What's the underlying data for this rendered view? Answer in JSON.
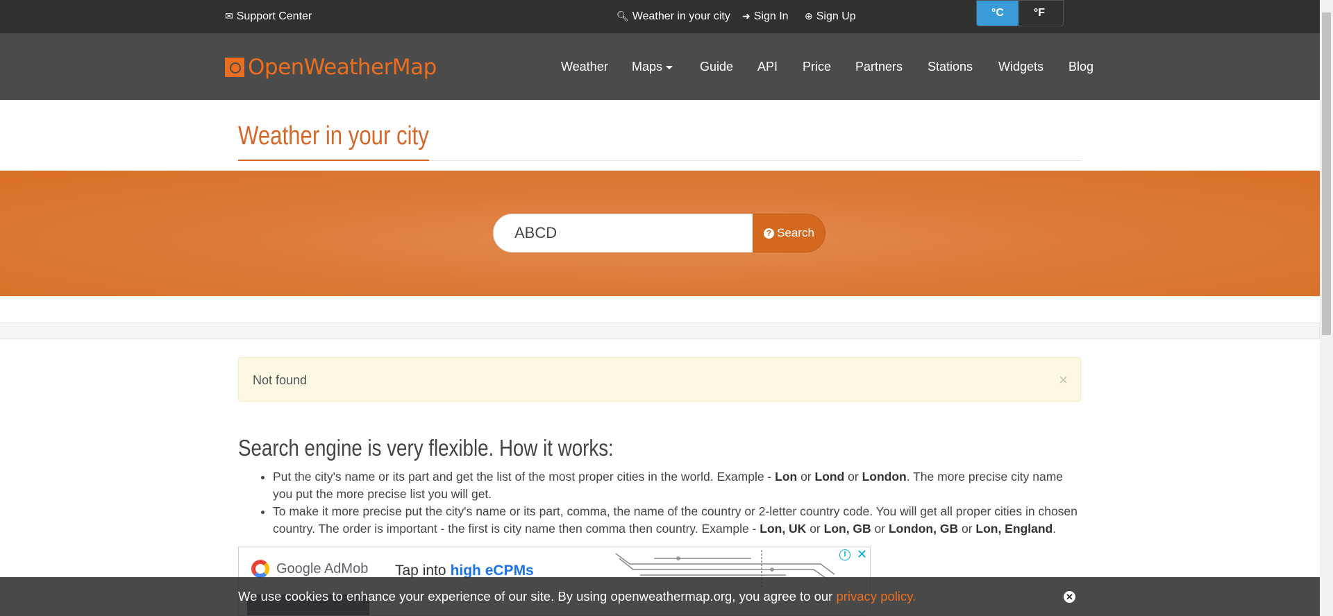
{
  "topbar": {
    "support": "Support Center",
    "weather_city": "Weather in your city",
    "sign_in": "Sign In",
    "sign_up": "Sign Up",
    "unit_c": "°C",
    "unit_f": "°F"
  },
  "navbar": {
    "logo": "OpenWeatherMap",
    "items": [
      "Weather",
      "Maps",
      "Guide",
      "API",
      "Price",
      "Partners",
      "Stations",
      "Widgets",
      "Blog"
    ]
  },
  "page": {
    "title": "Weather in your city"
  },
  "search": {
    "value": "ABCD",
    "button": "Search"
  },
  "alert": {
    "message": "Not found",
    "close": "×"
  },
  "info": {
    "title": "Search engine is very flexible. How it works:",
    "item1": {
      "t1": "Put the city's name or its part and get the list of the most proper cities in the world. Example - ",
      "b1": "Lon",
      "t2": " or ",
      "b2": "Lond",
      "t3": " or ",
      "b3": "London",
      "t4": ". The more precise city name you put the more precise list you will get."
    },
    "item2": {
      "t1": "To make it more precise put the city's name or its part, comma, the name of the country or 2-letter country code. You will get all proper cities in chosen country. The order is important - the first is city name then comma then country. Example - ",
      "b1": "Lon, UK",
      "t2": " or ",
      "b2": "Lon, GB",
      "t3": " or ",
      "b3": "London, GB",
      "t4": " or ",
      "b4": "Lon, England",
      "t5": "."
    }
  },
  "ad": {
    "brand": "Google AdMob",
    "tap": "Tap into",
    "highlight": "high eCPMs"
  },
  "cookie": {
    "text": "We use cookies to enhance your experience of our site. By using openweathermap.org, you agree to our ",
    "link": "privacy policy."
  },
  "colors": {
    "brand_orange": "#eb6e1e",
    "band_orange": "#d96f28",
    "celsius_active": "#3a9bd8"
  },
  "icons": [
    "envelope-icon",
    "search-icon",
    "sign-in-icon",
    "sign-up-icon",
    "logo-sun-icon",
    "caret-down-icon",
    "question-circle-icon",
    "close-icon",
    "adchoices-icon"
  ]
}
